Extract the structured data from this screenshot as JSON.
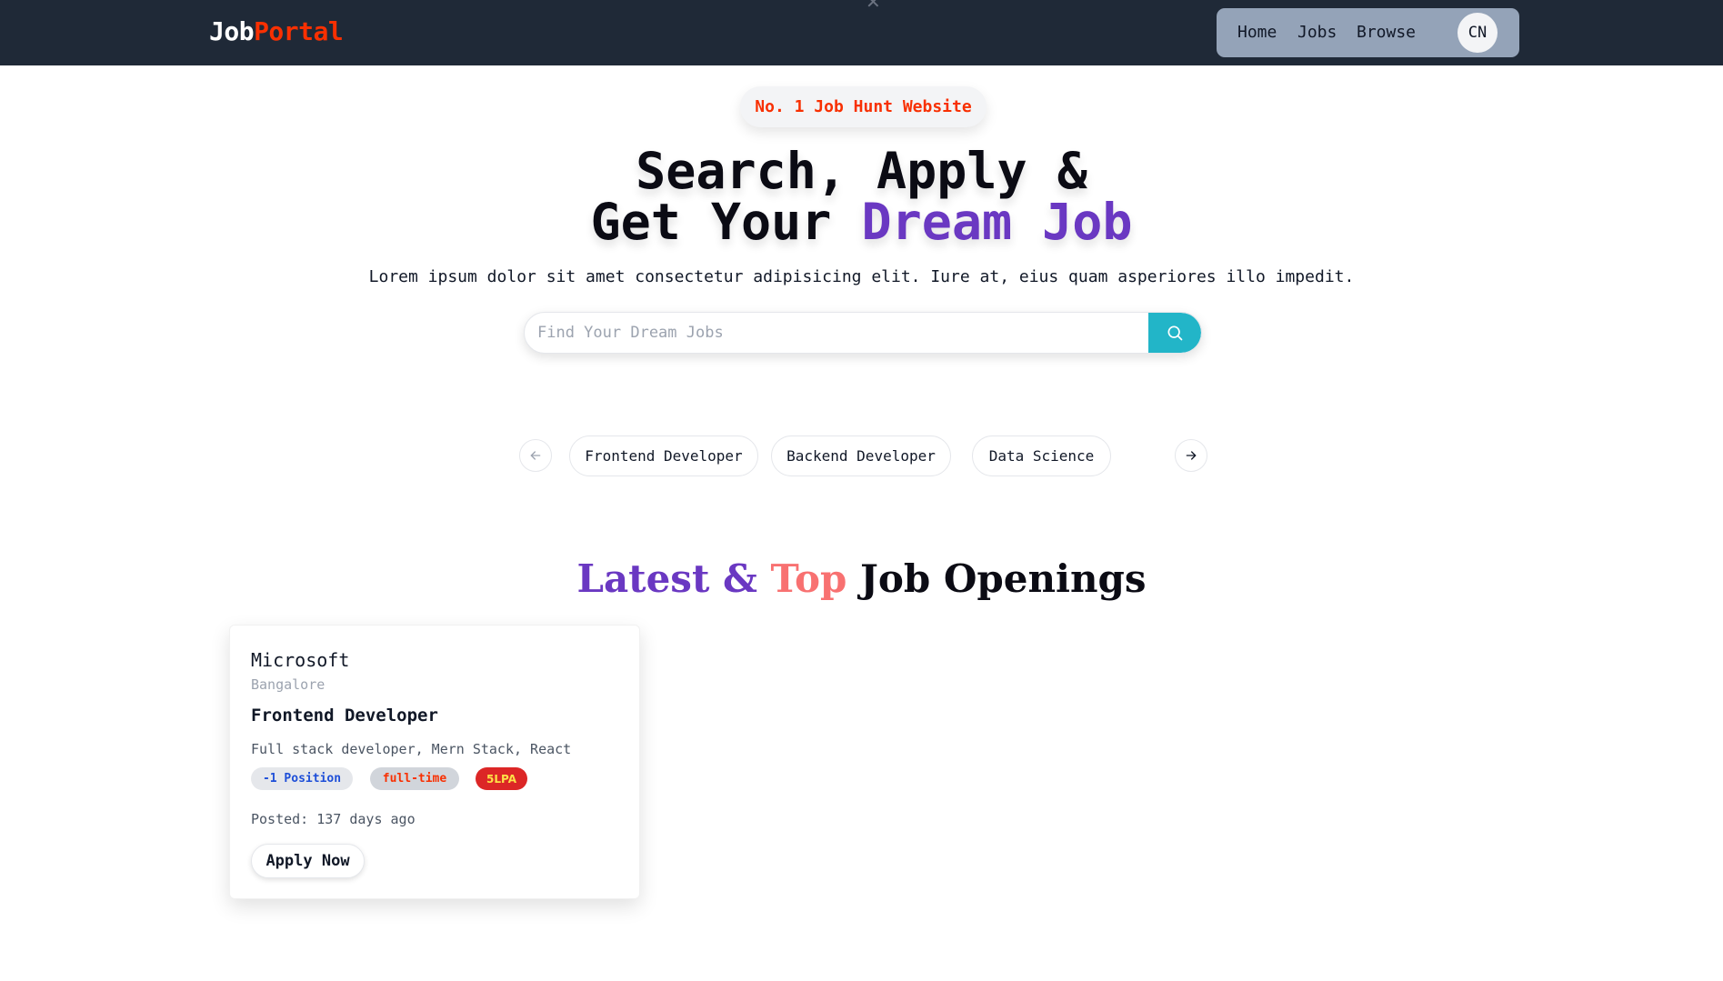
{
  "navbar": {
    "logo_main": "Job",
    "logo_accent": "Portal",
    "links": [
      "Home",
      "Jobs",
      "Browse"
    ],
    "avatar_initials": "CN"
  },
  "hero": {
    "tagline": "No. 1 Job Hunt Website",
    "title_line1": "Search, Apply &",
    "title_line2_prefix": "Get Your ",
    "title_line2_highlight": "Dream Job",
    "subtitle": "Lorem ipsum dolor sit amet consectetur adipisicing elit. Iure at, eius quam asperiores illo impedit.",
    "search_placeholder": "Find Your Dream Jobs"
  },
  "categories": [
    "Frontend Developer",
    "Backend Developer",
    "Data Science"
  ],
  "section": {
    "title_latest": "Latest & ",
    "title_top": "Top",
    "title_rest": " Job Openings"
  },
  "jobs": [
    {
      "company": "Microsoft",
      "location": "Bangalore",
      "title": "Frontend Developer",
      "description": "Full stack developer, Mern Stack, React",
      "positions": "-1 Position",
      "job_type": "full-time",
      "salary": "5LPA",
      "posted": "Posted: 137 days ago",
      "apply_label": "Apply Now"
    }
  ],
  "colors": {
    "navbar_bg": "#1f2937",
    "brand_red": "#f83002",
    "brand_purple": "#6a38c2",
    "search_teal": "#22b5c8"
  },
  "icons": {
    "search": "search-icon",
    "prev": "arrow-left-icon",
    "next": "arrow-right-icon",
    "close": "close-icon"
  }
}
